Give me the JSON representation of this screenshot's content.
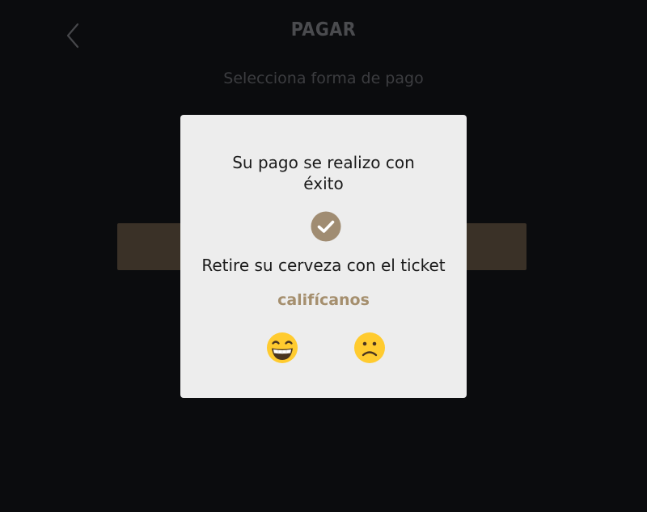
{
  "header": {
    "back_icon": "chevron-left-icon",
    "title": "PAGAR",
    "subtitle": "Selecciona forma de pago"
  },
  "modal": {
    "message": "Su pago se realizo con éxito",
    "check_icon": "check-circle-icon",
    "instruction": "Retire su cerveza con el ticket",
    "rate_label": "califícanos",
    "ratings": [
      {
        "icon": "grinning-face-icon"
      },
      {
        "icon": "frowning-face-icon"
      }
    ]
  },
  "colors": {
    "background": "#0b0c0e",
    "modal_bg": "#ededed",
    "accent": "#a58f6e",
    "check_circle": "#a08c72",
    "emoji_yellow": "#ffcb2f",
    "dimmed_button": "#3a3127"
  }
}
